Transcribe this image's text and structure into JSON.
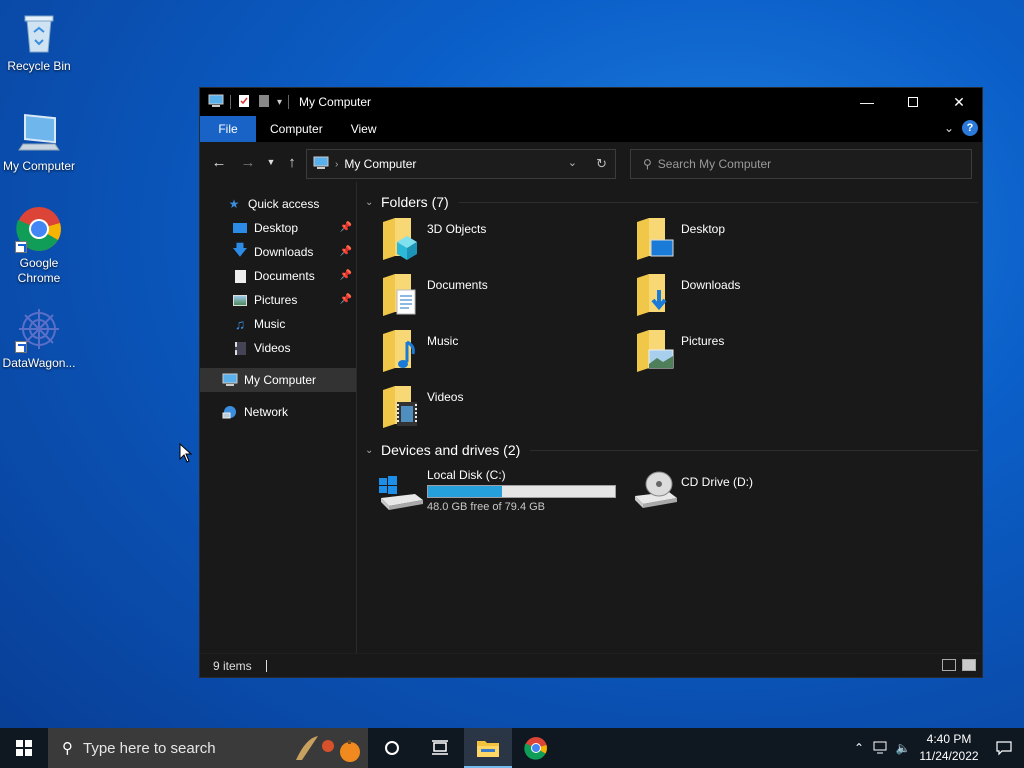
{
  "desktop": {
    "icons": [
      {
        "label": "Recycle Bin",
        "icon": "recycle-bin-icon"
      },
      {
        "label": "My Computer",
        "icon": "computer-icon"
      },
      {
        "label": "Google Chrome",
        "label_line1": "Google",
        "label_line2": "Chrome",
        "icon": "chrome-icon"
      },
      {
        "label": "DataWagon...",
        "icon": "datawagon-icon"
      }
    ]
  },
  "window": {
    "title": "My Computer",
    "ribbon_tabs": [
      "File",
      "Computer",
      "View"
    ],
    "address": {
      "crumb": "My Computer"
    },
    "search": {
      "placeholder": "Search My Computer"
    },
    "nav_pane": {
      "quick_access": "Quick access",
      "items": [
        {
          "label": "Desktop",
          "pinned": true
        },
        {
          "label": "Downloads",
          "pinned": true
        },
        {
          "label": "Documents",
          "pinned": true
        },
        {
          "label": "Pictures",
          "pinned": true
        },
        {
          "label": "Music",
          "pinned": false
        },
        {
          "label": "Videos",
          "pinned": false
        }
      ],
      "my_computer": "My Computer",
      "network": "Network"
    },
    "folders_group": {
      "title": "Folders (7)",
      "items": [
        "3D Objects",
        "Desktop",
        "Documents",
        "Downloads",
        "Music",
        "Pictures",
        "Videos"
      ]
    },
    "drives_group": {
      "title": "Devices and drives (2)",
      "local_disk": {
        "name": "Local Disk (C:)",
        "free_text": "48.0 GB free of 79.4 GB",
        "used_fraction": 0.395
      },
      "cd_drive": {
        "name": "CD Drive (D:)"
      }
    },
    "status": {
      "items": "9 items"
    }
  },
  "taskbar": {
    "search_placeholder": "Type here to search",
    "clock": {
      "time": "4:40 PM",
      "date": "11/24/2022"
    }
  },
  "colors": {
    "accent": "#1a63c6",
    "drive_fill": "#26a0da",
    "window_bg": "#191919"
  }
}
